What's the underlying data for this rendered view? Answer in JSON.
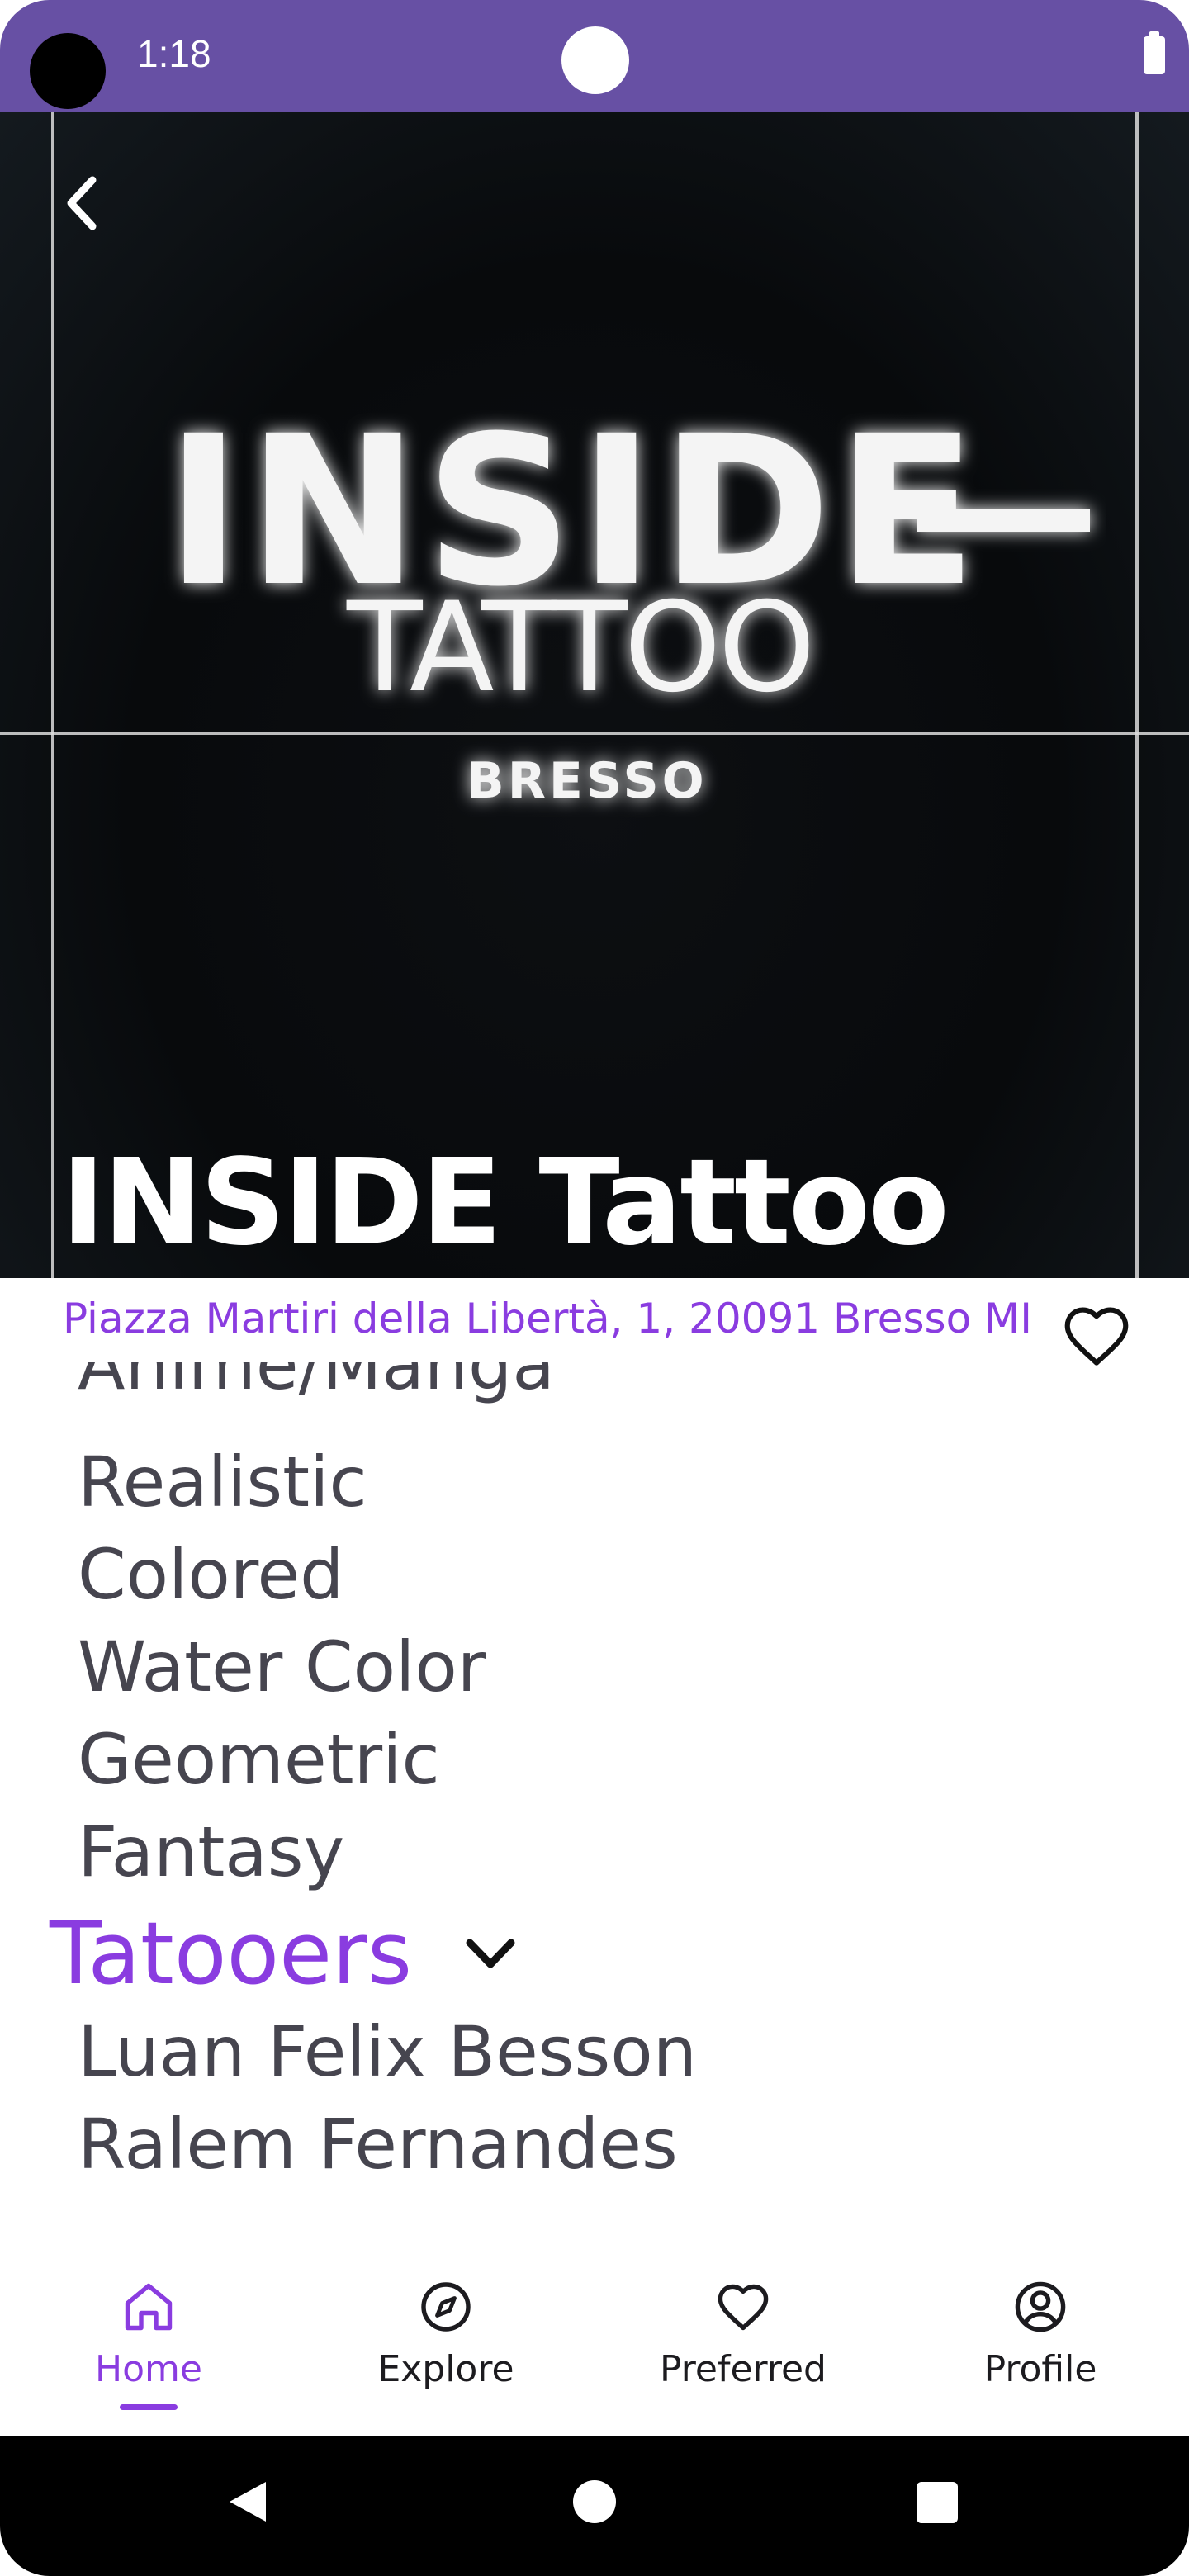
{
  "status_bar": {
    "time": "1:18"
  },
  "shop": {
    "logo_line1": "INSIDE",
    "logo_line2": "TATTOO",
    "logo_line3": "BRESSO",
    "name": "INSIDE Tattoo",
    "address": "Piazza Martiri della Libertà, 1, 20091 Bresso MI",
    "favorite": false
  },
  "styles": {
    "items": [
      "Anime/Manga",
      "Realistic",
      "Colored",
      "Water Color",
      "Geometric",
      "Fantasy"
    ]
  },
  "tattooers": {
    "title": "Tatooers",
    "expanded": true,
    "items": [
      "Luan Felix Besson",
      "Ralem Fernandes"
    ]
  },
  "bottom_nav": {
    "items": [
      {
        "label": "Home",
        "icon": "home-icon",
        "active": true
      },
      {
        "label": "Explore",
        "icon": "compass-icon",
        "active": false
      },
      {
        "label": "Preferred",
        "icon": "heart-icon",
        "active": false
      },
      {
        "label": "Profile",
        "icon": "account-circle-icon",
        "active": false
      }
    ]
  },
  "colors": {
    "accent": "#8a3ce0",
    "status_bar": "#6750a4",
    "text_secondary": "#46454f"
  }
}
